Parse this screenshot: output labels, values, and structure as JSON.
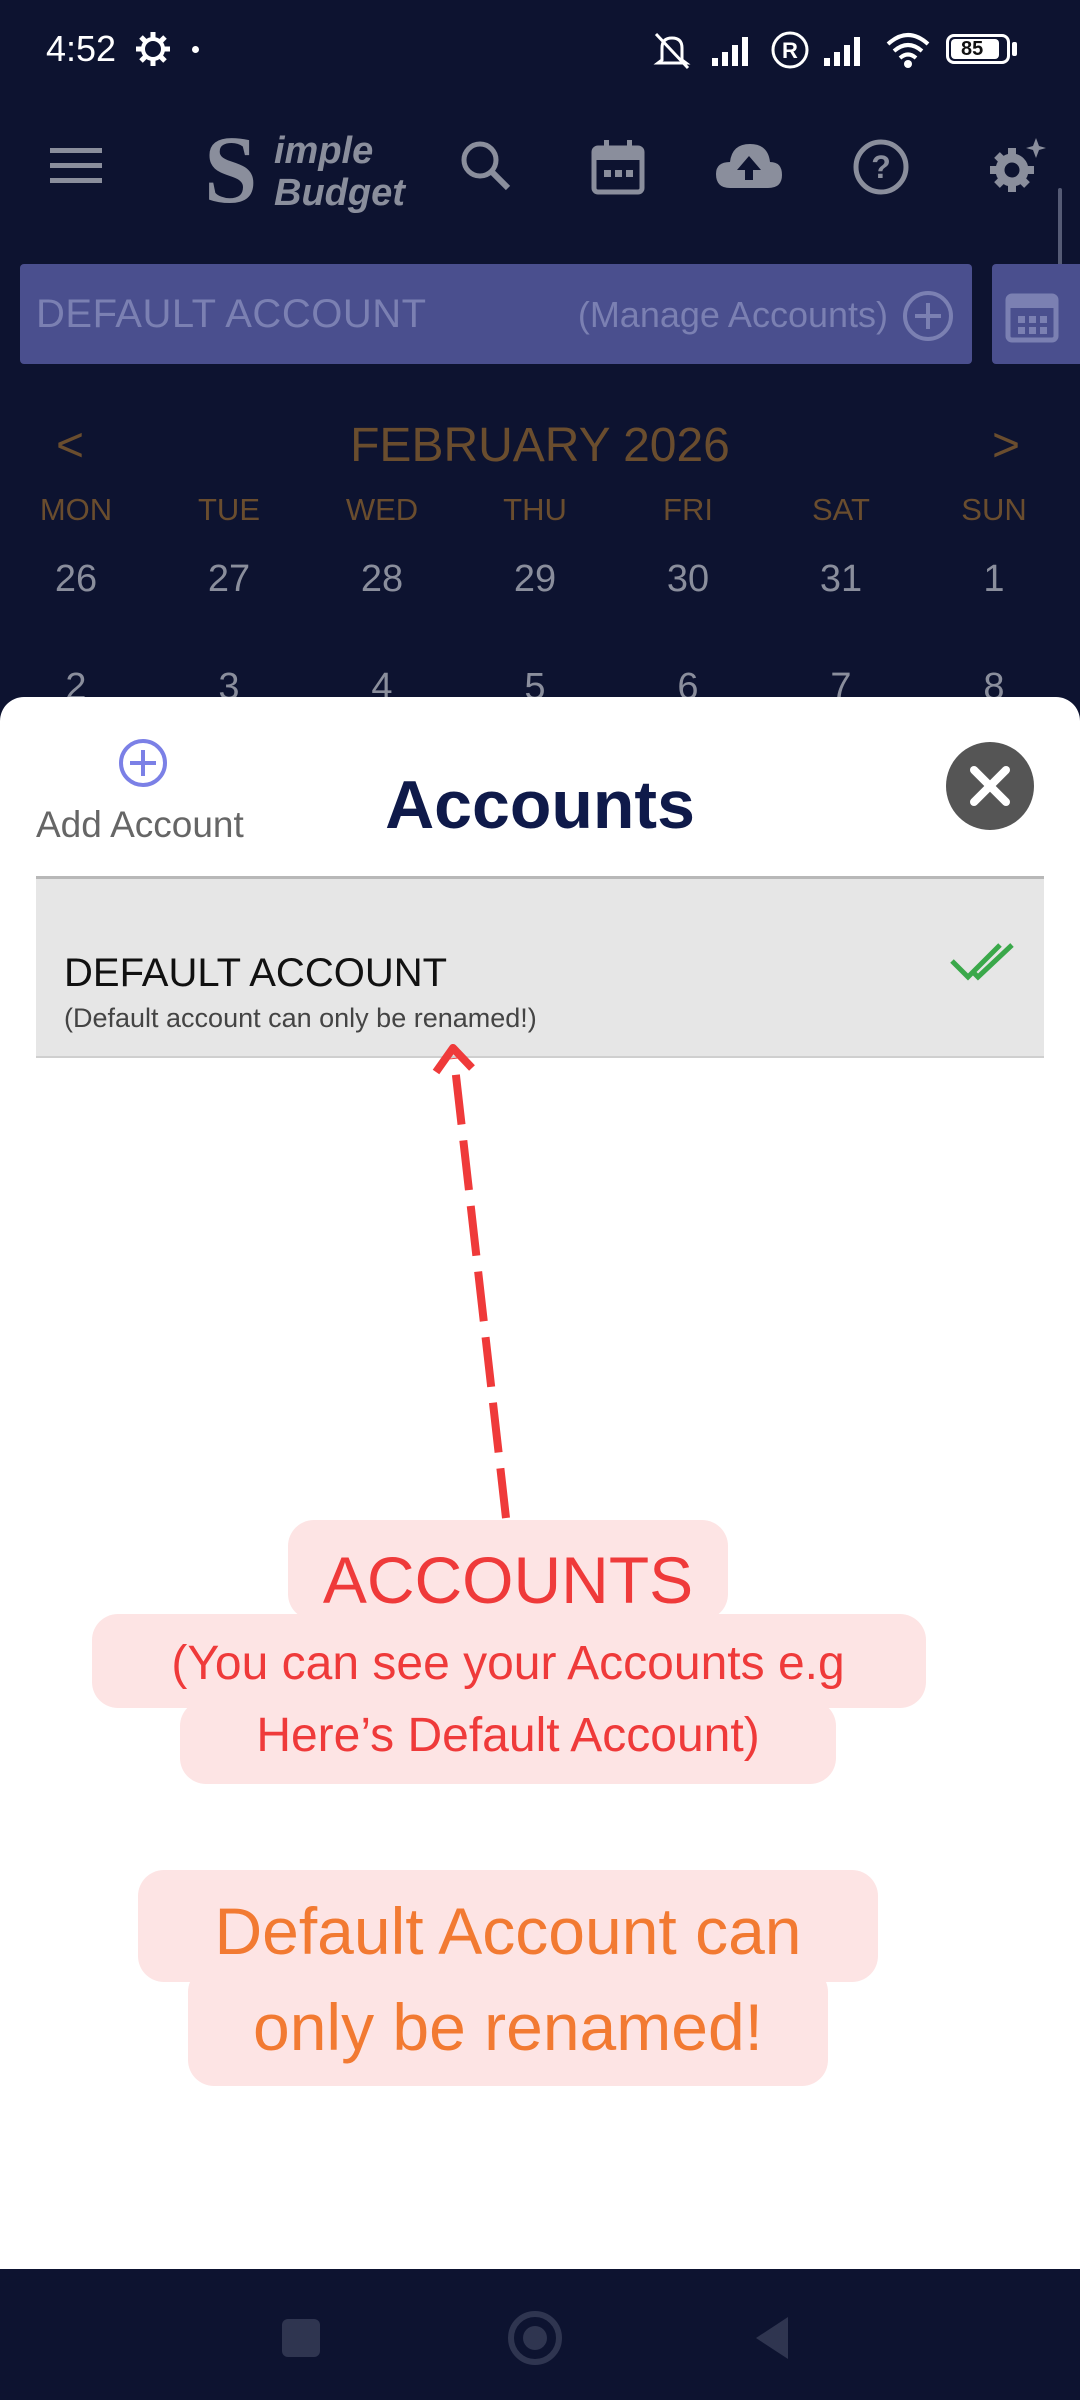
{
  "status_bar": {
    "time": "4:52",
    "battery": "85"
  },
  "app": {
    "logo_top": "imple",
    "logo_bottom": "Budget"
  },
  "account_bar": {
    "name": "DEFAULT ACCOUNT",
    "manage": "(Manage Accounts)"
  },
  "calendar": {
    "prev": "<",
    "next": ">",
    "month": "FEBRUARY 2026",
    "weekdays": [
      "MON",
      "TUE",
      "WED",
      "THU",
      "FRI",
      "SAT",
      "SUN"
    ],
    "week1": [
      "26",
      "27",
      "28",
      "29",
      "30",
      "31",
      "1"
    ],
    "week2": [
      "2",
      "3",
      "4",
      "5",
      "6",
      "7",
      "8"
    ]
  },
  "sheet": {
    "add_label": "Add Account",
    "title": "Accounts",
    "account": {
      "name": "DEFAULT ACCOUNT",
      "note": "(Default account can only be renamed!)"
    }
  },
  "annotations": {
    "accounts_title": "ACCOUNTS",
    "accounts_line1": "(You can see your Accounts e.g",
    "accounts_line2": "Here’s Default Account)",
    "rename_line1": "Default Account can",
    "rename_line2": "only be renamed!"
  },
  "colors": {
    "accent_red": "#ef3a3a",
    "accent_orange": "#f27a32",
    "check_green": "#3aa84a"
  }
}
